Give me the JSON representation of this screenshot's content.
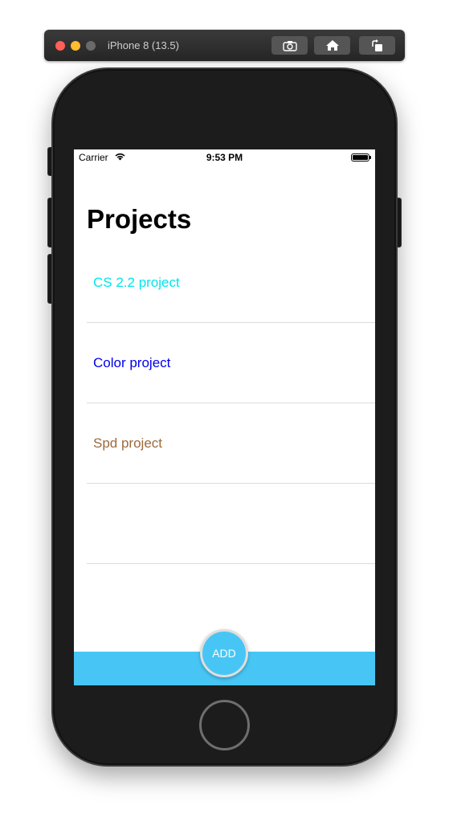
{
  "simulator": {
    "title": "iPhone 8 (13.5)",
    "buttons": [
      "screenshot-icon",
      "home-icon",
      "rotate-icon"
    ]
  },
  "status_bar": {
    "carrier": "Carrier",
    "time": "9:53 PM",
    "battery_level": 1.0
  },
  "page": {
    "title": "Projects"
  },
  "projects": [
    {
      "name": "CS 2.2 project",
      "color": "#00e5ee"
    },
    {
      "name": "Color project",
      "color": "#0000ee"
    },
    {
      "name": "Spd project",
      "color": "#9c6a3c"
    }
  ],
  "add_button": {
    "label": "ADD",
    "color": "#47c6f5"
  }
}
